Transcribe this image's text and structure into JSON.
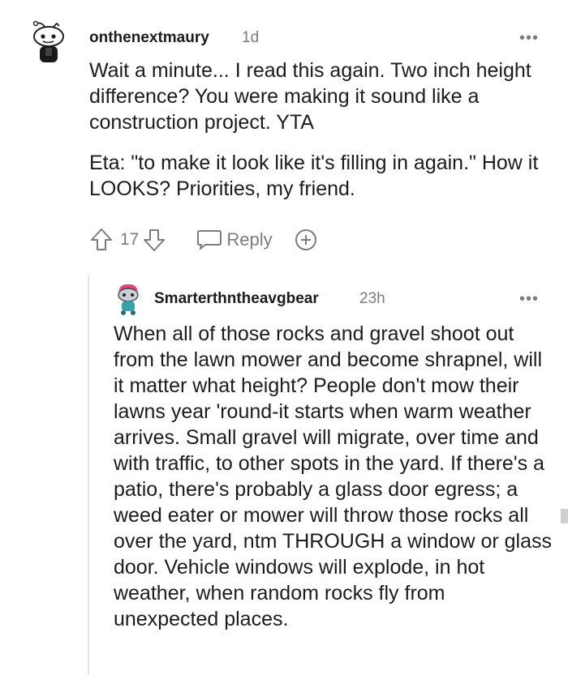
{
  "comment": {
    "username": "onthenextmaury",
    "age": "1d",
    "paragraphs": [
      "Wait a minute... I read this again. Two inch height difference? You were making it sound like a construction project. YTA",
      "Eta: \"to make it look like it's filling in again.\" How it LOOKS? Priorities, my friend."
    ],
    "vote_count": "17",
    "reply_label": "Reply"
  },
  "reply": {
    "username": "Smarterthntheavgbear",
    "age": "23h",
    "text": "When all of those rocks and gravel shoot out from the lawn mower and become shrapnel, will it matter what height? People don't mow their lawns year 'round-it starts when warm weather arrives. Small gravel will migrate, over time and with traffic, to other spots in the yard. If there's a patio, there's probably a glass door egress; a weed eater or mower will throw those rocks all over the yard, ntm THROUGH a window or glass door. Vehicle windows will explode, in hot weather, when random rocks fly from unexpected places."
  },
  "icons": {
    "more": "more-options-icon",
    "upvote": "upvote-arrow-icon",
    "downvote": "downvote-arrow-icon",
    "reply": "speech-bubble-icon",
    "award": "add-award-icon"
  },
  "colors": {
    "text": "#1c1c1c",
    "meta": "#7c7c7c",
    "thread_line": "#e4e4e4"
  }
}
